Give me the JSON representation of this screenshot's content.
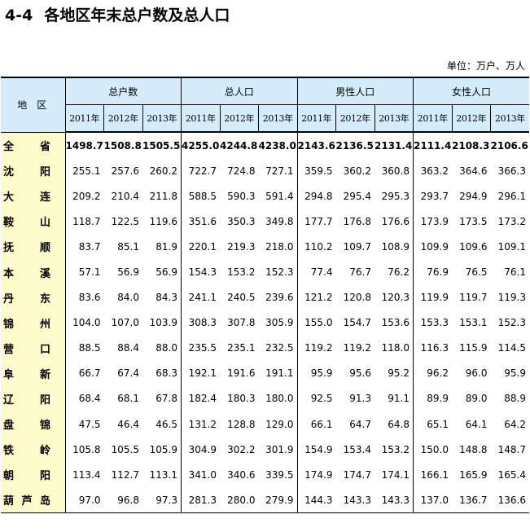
{
  "title": {
    "number": "4-4",
    "text": "各地区年末总户数及总人口"
  },
  "unit": "单位：万户、万人",
  "table": {
    "region_header": "地区",
    "groups": [
      "总户数",
      "总人口",
      "男性人口",
      "女性人口"
    ],
    "years": [
      "2011年",
      "2012年",
      "2013年"
    ],
    "rows": [
      {
        "name": "全省",
        "values": [
          "1498.7",
          "1508.8",
          "1505.5",
          "4255.0",
          "4244.8",
          "4238.0",
          "2143.6",
          "2136.5",
          "2131.4",
          "2111.4",
          "2108.3",
          "2106.6"
        ]
      },
      {
        "name": "沈阳",
        "values": [
          "255.1",
          "257.6",
          "260.2",
          "722.7",
          "724.8",
          "727.1",
          "359.5",
          "360.2",
          "360.8",
          "363.2",
          "364.6",
          "366.3"
        ]
      },
      {
        "name": "大连",
        "values": [
          "209.2",
          "210.4",
          "211.8",
          "588.5",
          "590.3",
          "591.4",
          "294.8",
          "295.4",
          "295.3",
          "293.7",
          "294.9",
          "296.1"
        ]
      },
      {
        "name": "鞍山",
        "values": [
          "118.7",
          "122.5",
          "119.6",
          "351.6",
          "350.3",
          "349.8",
          "177.7",
          "176.8",
          "176.6",
          "173.9",
          "173.5",
          "173.2"
        ]
      },
      {
        "name": "抚顺",
        "values": [
          "83.7",
          "85.1",
          "81.9",
          "220.1",
          "219.3",
          "218.0",
          "110.2",
          "109.7",
          "108.9",
          "109.9",
          "109.6",
          "109.1"
        ]
      },
      {
        "name": "本溪",
        "values": [
          "57.1",
          "56.9",
          "56.9",
          "154.3",
          "153.2",
          "152.3",
          "77.4",
          "76.7",
          "76.2",
          "76.9",
          "76.5",
          "76.1"
        ]
      },
      {
        "name": "丹东",
        "values": [
          "83.6",
          "84.0",
          "84.3",
          "241.1",
          "240.5",
          "239.6",
          "121.2",
          "120.8",
          "120.3",
          "119.9",
          "119.7",
          "119.3"
        ]
      },
      {
        "name": "锦州",
        "values": [
          "104.0",
          "107.0",
          "103.9",
          "308.3",
          "307.8",
          "305.9",
          "155.0",
          "154.7",
          "153.6",
          "153.3",
          "153.1",
          "152.3"
        ]
      },
      {
        "name": "营口",
        "values": [
          "88.5",
          "88.4",
          "88.0",
          "235.5",
          "235.1",
          "232.5",
          "119.2",
          "119.2",
          "118.0",
          "116.3",
          "115.9",
          "114.5"
        ]
      },
      {
        "name": "阜新",
        "values": [
          "66.7",
          "67.4",
          "68.3",
          "192.1",
          "191.6",
          "191.1",
          "95.9",
          "95.6",
          "95.2",
          "96.2",
          "96.0",
          "95.9"
        ]
      },
      {
        "name": "辽阳",
        "values": [
          "68.4",
          "68.1",
          "67.8",
          "182.4",
          "180.3",
          "180.0",
          "92.5",
          "91.3",
          "91.1",
          "89.9",
          "89.0",
          "88.9"
        ]
      },
      {
        "name": "盘锦",
        "values": [
          "47.5",
          "46.4",
          "46.5",
          "131.2",
          "128.8",
          "129.0",
          "66.1",
          "64.7",
          "64.8",
          "65.1",
          "64.1",
          "64.2"
        ]
      },
      {
        "name": "铁岭",
        "values": [
          "105.8",
          "105.5",
          "105.9",
          "304.9",
          "302.2",
          "301.9",
          "154.9",
          "153.4",
          "153.2",
          "150.0",
          "148.8",
          "148.7"
        ]
      },
      {
        "name": "朝阳",
        "values": [
          "113.4",
          "112.7",
          "113.1",
          "341.0",
          "340.6",
          "339.5",
          "174.9",
          "174.7",
          "174.1",
          "166.1",
          "165.9",
          "165.4"
        ]
      },
      {
        "name": "葫芦岛",
        "values": [
          "97.0",
          "96.8",
          "97.3",
          "281.3",
          "280.0",
          "279.9",
          "144.3",
          "143.3",
          "143.3",
          "137.0",
          "136.7",
          "136.6"
        ]
      }
    ]
  }
}
